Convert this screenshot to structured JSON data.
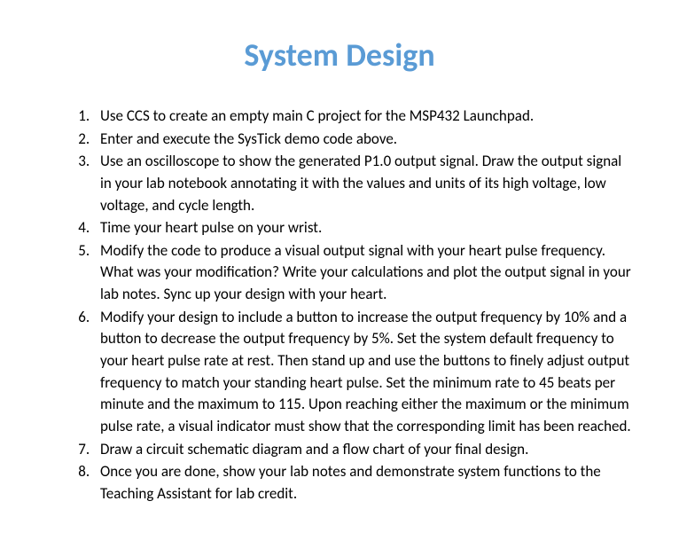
{
  "title": "System Design",
  "items": [
    "Use CCS to create an empty main C project for the MSP432 Launchpad.",
    "Enter and execute the SysTick demo code above.",
    "Use an oscilloscope to show the generated P1.0 output signal. Draw the output signal in your lab notebook annotating it with the values and units of its high voltage, low voltage, and cycle length.",
    "Time your heart pulse on your wrist.",
    "Modify the code to produce a visual output signal with your heart pulse frequency. What was your modification? Write your calculations and plot the output signal in your lab notes. Sync up your design with your heart.",
    "Modify your design to include a button to increase the output frequency by 10% and a button to decrease the output frequency by 5%. Set the system default frequency to your heart pulse rate at rest. Then stand up and use the buttons to finely adjust output frequency to match your standing heart pulse. Set the minimum rate to 45 beats per minute and the maximum to 115. Upon reaching either the maximum or the minimum pulse rate, a visual indicator must show that the corresponding limit has been reached.",
    "Draw a circuit schematic diagram and a flow chart of your final design.",
    "Once you are done, show your lab notes and demonstrate system functions to the Teaching Assistant for lab credit."
  ]
}
